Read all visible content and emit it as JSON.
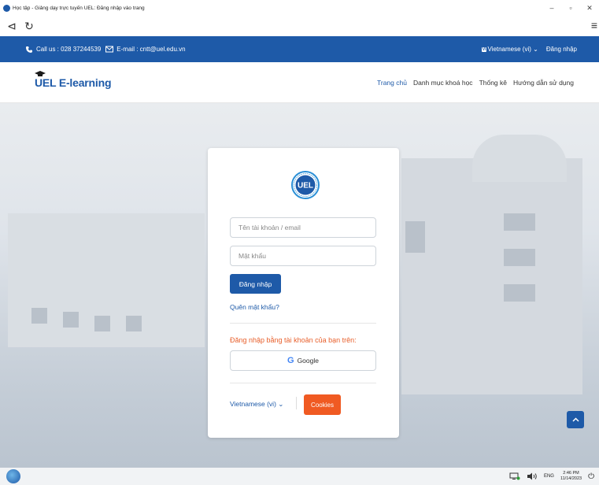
{
  "window": {
    "title": "Học tập - Giảng dạy trực tuyến UEL: Đăng nhập vào trang",
    "min": "–",
    "restore": "▫",
    "close": "✕"
  },
  "browser": {
    "back": "⊲",
    "reload": "↻",
    "menu": "≡"
  },
  "infobar": {
    "phone": "Call us : 028 37244539",
    "email": "E-mail : cntt@uel.edu.vn",
    "language": "Vietnamese (vi)",
    "lang_badge": "VI",
    "login": "Đăng nhập"
  },
  "header": {
    "logo": "UEL E-learning",
    "nav": [
      "Trang chủ",
      "Danh mục khoá học",
      "Thống kê",
      "Hướng dẫn sử dụng"
    ]
  },
  "login": {
    "seal_text": "UEL",
    "username_placeholder": "Tên tài khoản / email",
    "password_placeholder": "Mật khẩu",
    "submit": "Đăng nhập",
    "forgot": "Quên mật khẩu?",
    "alt_title": "Đăng nhập bằng tài khoản của bạn trên:",
    "google": "Google",
    "language": "Vietnamese (vi)",
    "cookies": "Cookies"
  },
  "taskbar": {
    "lang": "ENG",
    "time": "2:46 PM",
    "date": "11/14/2023"
  },
  "colors": {
    "primary": "#1e5aa8",
    "accent": "#f05a22"
  }
}
